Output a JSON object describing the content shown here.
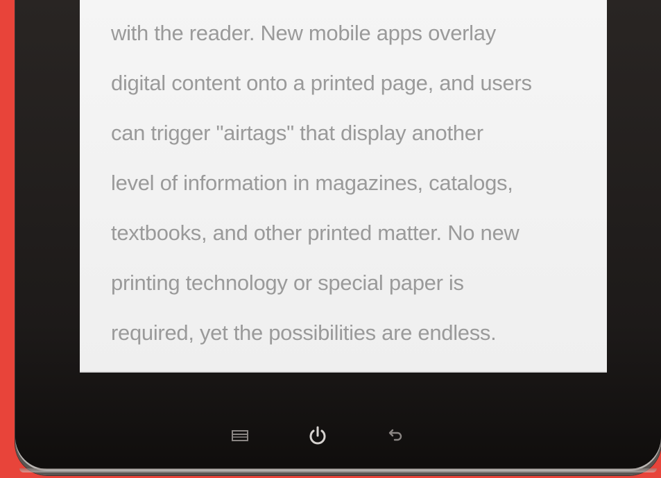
{
  "colors": {
    "background": "#e8443a",
    "bezel": "#1d1a19",
    "screen": "#f2f2f2",
    "text": "#9a9a9a",
    "icon": "#8a8583"
  },
  "reader": {
    "lines": [
      "with the reader. New mobile apps overlay",
      "digital content onto a printed page, and users",
      "can trigger \"airtags\" that display another",
      "level of information in magazines, catalogs,",
      "textbooks, and other printed matter. No new",
      "printing technology or special paper is",
      "required, yet the possibilities are endless."
    ]
  },
  "controls": {
    "icons": [
      "menu-icon",
      "power-icon",
      "back-icon"
    ]
  }
}
